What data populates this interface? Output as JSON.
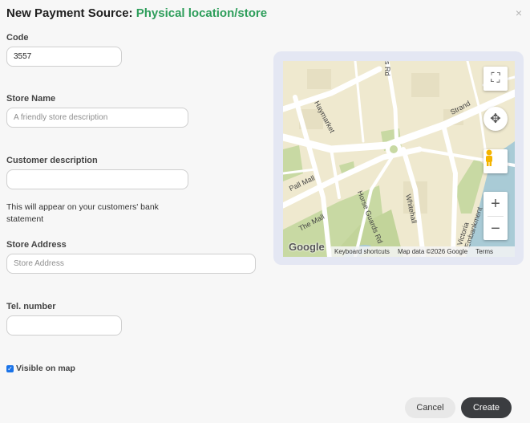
{
  "dialog": {
    "title_prefix": "New Payment Source: ",
    "title_accent": "Physical location/store",
    "close_symbol": "×"
  },
  "form": {
    "code_label": "Code",
    "code_value": "3557",
    "store_name_label": "Store Name",
    "store_name_placeholder": "A friendly store description",
    "customer_description_label": "Customer description",
    "customer_description_value": "",
    "customer_description_hint": "This will appear on your customers' bank statement",
    "store_address_label": "Store Address",
    "store_address_placeholder": "Store Address",
    "tel_label": "Tel. number",
    "tel_value": "",
    "visible_on_map_label": "Visible on map",
    "visible_on_map_checked": true
  },
  "map": {
    "street_labels": [
      "Haymarket",
      "Strand",
      "Pall Mall",
      "The Mall",
      "Horse Guards Rd",
      "Whitehall",
      "Victoria Embankment",
      "s Rd"
    ],
    "logo": "Google",
    "keyboard_shortcuts": "Keyboard shortcuts",
    "map_data": "Map data ©2026 Google",
    "terms": "Terms",
    "zoom_in": "+",
    "zoom_out": "−",
    "colors": {
      "land": "#efe9cf",
      "road": "#ffffff",
      "park": "#c8d9a3",
      "water": "#a9cbd6"
    }
  },
  "actions": {
    "cancel": "Cancel",
    "create": "Create"
  },
  "colors": {
    "accent": "#2e9e5b",
    "checkbox": "#1a73e8",
    "primary_button": "#3b3d40"
  }
}
